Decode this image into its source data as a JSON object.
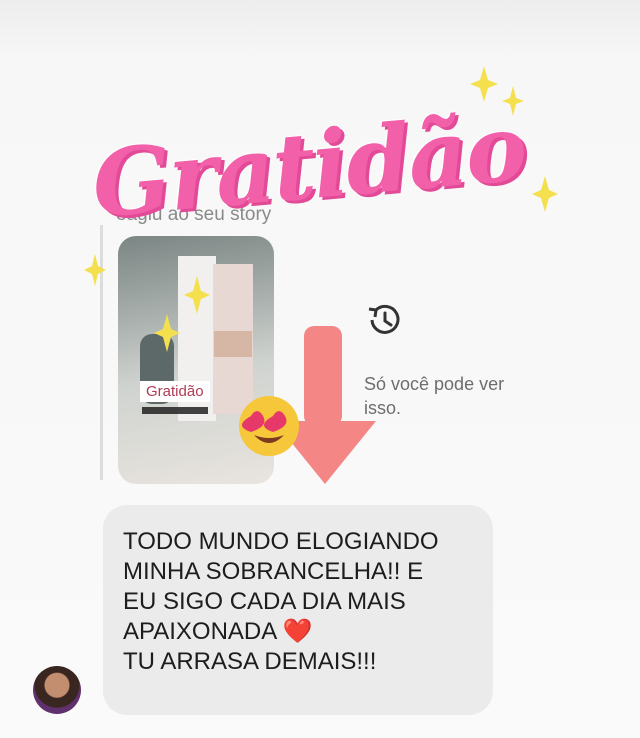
{
  "reply": {
    "label": "eagiu ao seu story",
    "thumbnail_caption": "Gratidão"
  },
  "notice": {
    "icon": "history-icon",
    "text": "Só você pode ver isso."
  },
  "sticker": {
    "text": "Gratidão"
  },
  "message": {
    "lines": [
      "TODO MUNDO ELOGIANDO",
      "MINHA SOBRANCELHA!! E",
      "EU SIGO CADA DIA MAIS",
      "APAIXONADA ❤️",
      "TU ARRASA DEMAIS!!!"
    ]
  },
  "colors": {
    "sticker": "#f260a9",
    "arrow": "#f58686",
    "sparkle": "#f4e04f",
    "bubble": "#ebebeb"
  }
}
